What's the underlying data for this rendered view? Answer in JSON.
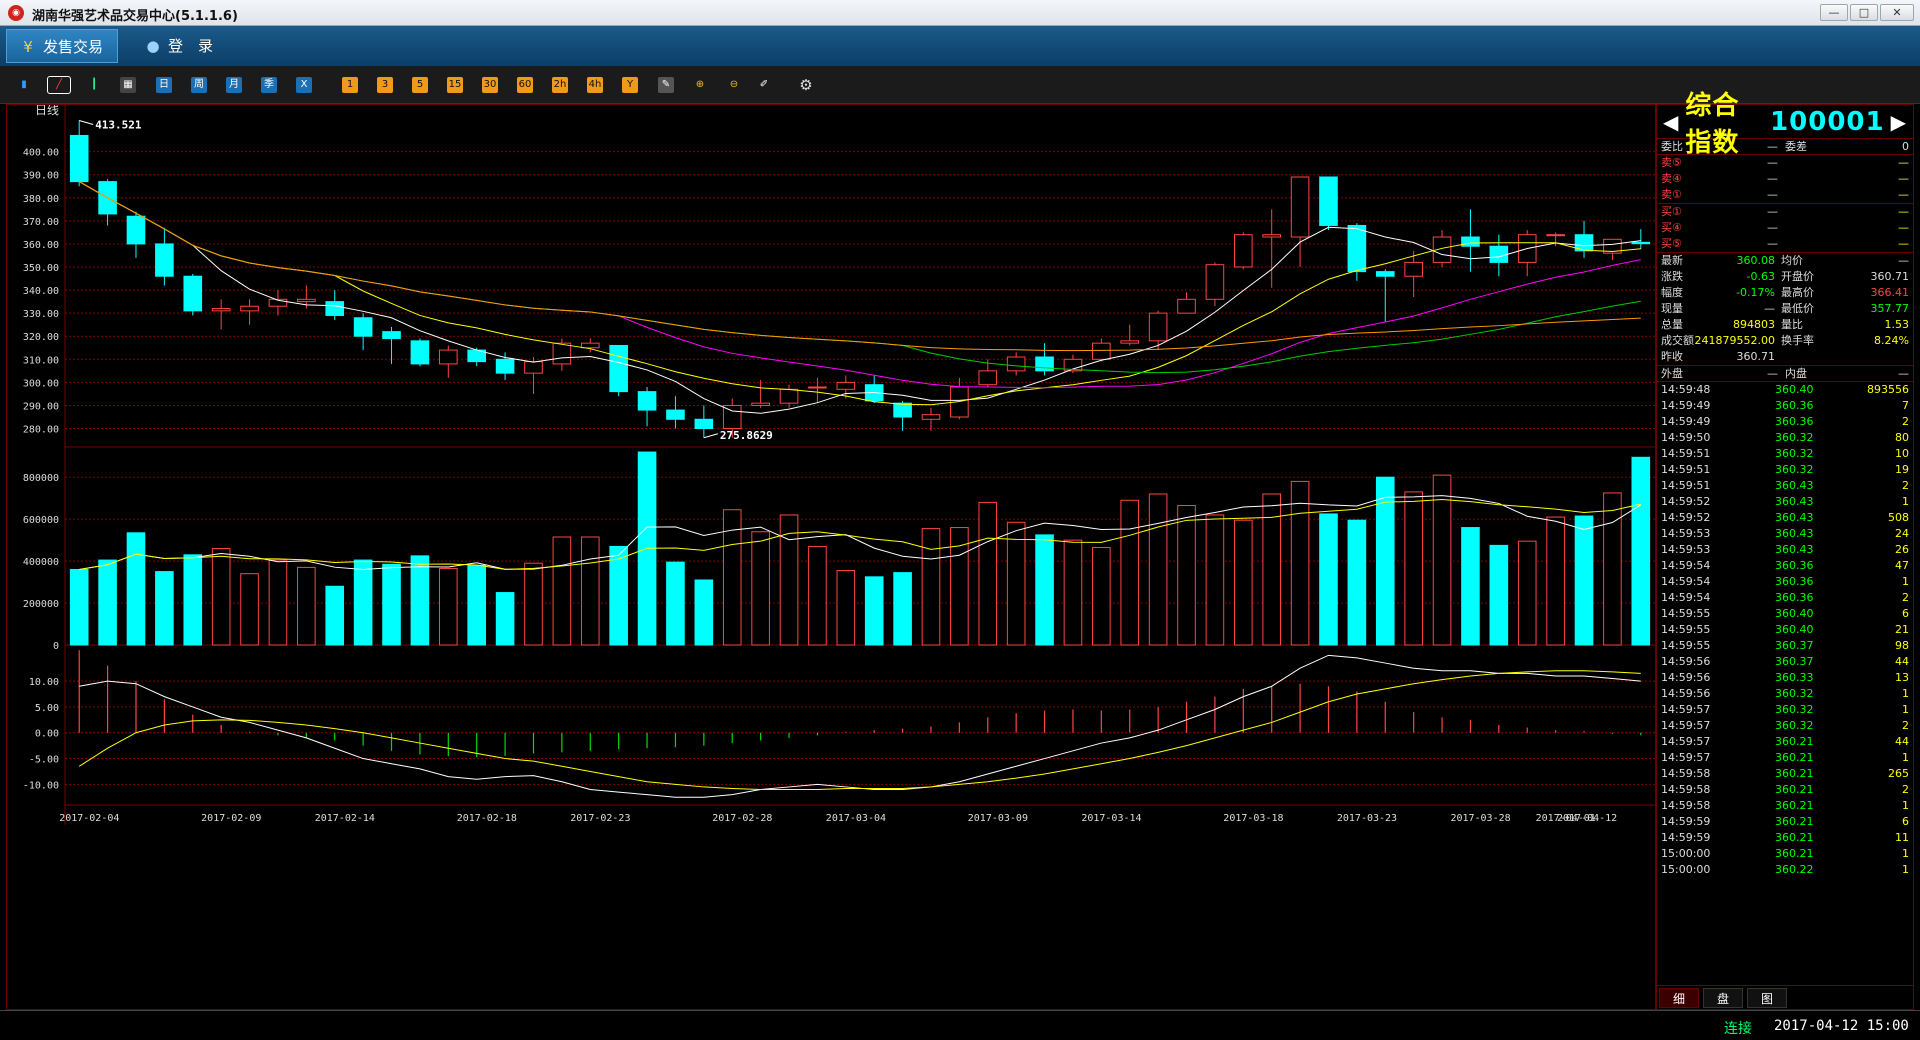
{
  "window": {
    "title": "湖南华强艺术品交易中心(5.1.1.6)",
    "controls": [
      "—",
      "□",
      "✕"
    ]
  },
  "menu": {
    "items": [
      {
        "label": "发售交易",
        "icon": "¥"
      },
      {
        "label": "登　录",
        "icon": "👤"
      }
    ]
  },
  "toolbar": {
    "icons": [
      "bar-chart-icon",
      "line-chart-icon",
      "candle-chart-icon",
      "calendar-icon"
    ],
    "periods_blue": [
      "日",
      "周",
      "月",
      "季",
      "X"
    ],
    "periods_orange": [
      "1",
      "3",
      "5",
      "15",
      "30",
      "60",
      "2h",
      "4h",
      "Y"
    ],
    "tools": [
      "draw-icon",
      "zoom-in-icon",
      "zoom-out-icon",
      "pen-icon",
      "gear-icon"
    ]
  },
  "chart_data": {
    "type": "candlestick",
    "period_label": "日线",
    "high_label": "413.521",
    "low_label": "275.8629",
    "price_ticks": [
      "400.00",
      "390.00",
      "380.00",
      "370.00",
      "360.00",
      "350.00",
      "340.00",
      "330.00",
      "320.00",
      "310.00",
      "300.00",
      "290.00",
      "280.00"
    ],
    "vol_ticks": [
      "800000",
      "600000",
      "400000",
      "200000",
      "0"
    ],
    "macd_ticks": [
      "10.00",
      "5.00",
      "0.00",
      "-5.00",
      "-10.00"
    ],
    "dates": [
      "2017-02-04",
      "2017-02-09",
      "2017-02-14",
      "2017-02-18",
      "2017-02-23",
      "2017-02-28",
      "2017-03-04",
      "2017-03-09",
      "2017-03-14",
      "2017-03-18",
      "2017-03-23",
      "2017-03-28",
      "2017-04-01",
      "2017-04-12"
    ],
    "candles": [
      [
        407,
        387,
        413.5,
        385
      ],
      [
        387,
        373,
        388,
        368
      ],
      [
        372,
        360,
        374,
        354
      ],
      [
        360,
        346,
        367,
        342
      ],
      [
        346,
        331,
        347,
        329
      ],
      [
        331,
        332,
        336,
        323
      ],
      [
        331,
        333,
        336,
        325
      ],
      [
        333,
        336,
        340,
        329
      ],
      [
        335,
        336,
        342,
        332
      ],
      [
        335,
        329,
        340,
        327
      ],
      [
        328,
        320,
        330,
        314
      ],
      [
        322,
        319,
        324,
        308
      ],
      [
        318,
        308,
        319,
        307
      ],
      [
        308,
        314,
        316,
        302
      ],
      [
        314,
        309,
        315,
        307
      ],
      [
        310,
        304,
        313,
        301
      ],
      [
        304,
        309,
        311,
        295
      ],
      [
        308,
        317,
        319,
        305
      ],
      [
        315,
        317,
        319,
        313
      ],
      [
        316,
        296,
        316,
        294
      ],
      [
        296,
        288,
        298,
        281
      ],
      [
        288,
        284,
        294,
        280
      ],
      [
        284,
        280,
        290,
        276
      ],
      [
        280,
        290,
        293,
        276
      ],
      [
        290,
        291,
        301,
        289
      ],
      [
        291,
        297,
        299,
        289
      ],
      [
        298,
        298,
        302,
        291
      ],
      [
        297,
        300,
        303,
        293
      ],
      [
        299,
        292,
        303,
        291
      ],
      [
        291,
        285,
        292,
        279
      ],
      [
        284,
        286,
        289,
        279
      ],
      [
        285,
        298,
        302,
        284
      ],
      [
        299,
        305,
        310,
        298
      ],
      [
        305,
        311,
        313,
        303
      ],
      [
        311,
        305,
        317,
        303
      ],
      [
        305,
        310,
        312,
        304
      ],
      [
        310,
        317,
        319,
        309
      ],
      [
        317,
        318,
        325,
        316
      ],
      [
        318,
        330,
        331,
        314
      ],
      [
        330,
        336,
        339,
        331
      ],
      [
        336,
        351,
        352,
        333
      ],
      [
        350,
        364,
        365,
        349
      ],
      [
        363,
        364,
        375,
        341
      ],
      [
        363,
        389,
        389,
        350
      ],
      [
        389,
        368,
        389,
        366
      ],
      [
        368,
        348,
        369,
        344
      ],
      [
        348,
        346,
        349,
        326
      ],
      [
        346,
        352,
        357,
        337
      ],
      [
        352,
        363,
        366,
        350
      ],
      [
        363,
        359,
        375,
        348
      ],
      [
        359,
        352,
        364,
        346
      ],
      [
        352,
        364,
        366,
        346
      ],
      [
        364,
        364,
        365,
        359
      ],
      [
        364,
        357,
        370,
        354
      ],
      [
        356,
        362,
        362,
        353
      ],
      [
        360.7,
        360.1,
        366.4,
        357.8
      ]
    ],
    "volumes": [
      360,
      405,
      535,
      350,
      430,
      460,
      340,
      405,
      370,
      280,
      405,
      385,
      425,
      365,
      380,
      250,
      390,
      515,
      515,
      470,
      920,
      395,
      310,
      645,
      540,
      620,
      470,
      355,
      325,
      345,
      555,
      560,
      680,
      585,
      525,
      500,
      465,
      690,
      720,
      665,
      620,
      595,
      720,
      780,
      625,
      595,
      800,
      730,
      810,
      560,
      475,
      495,
      610,
      615,
      725,
      895
    ],
    "macd_hist": [
      16,
      13,
      10,
      6.5,
      3.5,
      1.5,
      0.2,
      -0.5,
      -1,
      -1.5,
      -2.5,
      -3.5,
      -4.2,
      -4.5,
      -4.7,
      -4.5,
      -4,
      -3.8,
      -3.5,
      -3.2,
      -3,
      -2.8,
      -2.5,
      -2,
      -1.5,
      -1,
      -0.5,
      0.2,
      0.5,
      0.8,
      1.2,
      2,
      3,
      3.8,
      4.3,
      4.5,
      4.3,
      4.5,
      5,
      6,
      7,
      8.5,
      9,
      9.5,
      9,
      8,
      6,
      4,
      3,
      2.5,
      1.5,
      1,
      0.5,
      0.3,
      -0.2,
      -0.5
    ],
    "macd_dif": [
      9,
      10,
      9.5,
      7,
      5,
      3,
      2,
      0.5,
      -1,
      -3,
      -5,
      -6,
      -7,
      -8.5,
      -9,
      -8.5,
      -8.3,
      -9.5,
      -11,
      -11.5,
      -12,
      -12.5,
      -12.5,
      -12,
      -11,
      -10.5,
      -10,
      -10.5,
      -11,
      -11,
      -10.5,
      -9.5,
      -8,
      -6.5,
      -5,
      -3.5,
      -2,
      -1,
      0.5,
      2.5,
      4.5,
      7,
      9,
      12.5,
      15,
      14.5,
      13.5,
      12.5,
      12,
      12,
      11.5,
      11.5,
      11,
      11,
      10.5,
      10
    ],
    "macd_dea": [
      -6.5,
      -3,
      0,
      1.5,
      2.3,
      2.5,
      2.4,
      2,
      1.5,
      0.8,
      0,
      -1,
      -2,
      -3,
      -4,
      -5,
      -5.5,
      -6.5,
      -7.5,
      -8.5,
      -9.5,
      -10,
      -10.5,
      -10.8,
      -11,
      -11,
      -11,
      -10.8,
      -10.8,
      -10.8,
      -10.5,
      -10,
      -9.5,
      -8.8,
      -8,
      -7,
      -6,
      -5,
      -3.8,
      -2.5,
      -1,
      0.5,
      2,
      4,
      6,
      7.5,
      8.5,
      9.5,
      10.3,
      11,
      11.5,
      11.8,
      12,
      12,
      11.8,
      11.5
    ]
  },
  "quote": {
    "name": "综合指数",
    "code": "100001",
    "weibi": {
      "label": "委比",
      "value": "—",
      "label2": "委差",
      "value2": "0"
    },
    "sell": [
      {
        "label": "卖⑤",
        "price": "—",
        "vol": "—"
      },
      {
        "label": "卖④",
        "price": "—",
        "vol": "—"
      },
      {
        "label": "卖①",
        "price": "—",
        "vol": "—"
      }
    ],
    "buy": [
      {
        "label": "买①",
        "price": "—",
        "vol": "—"
      },
      {
        "label": "买④",
        "price": "—",
        "vol": "—"
      },
      {
        "label": "买⑤",
        "price": "—",
        "vol": "—"
      }
    ],
    "stats": [
      {
        "l1": "最新",
        "v1": "360.08",
        "c1": "cg",
        "l2": "均价",
        "v2": "—",
        "c2": "cw"
      },
      {
        "l1": "涨跌",
        "v1": "-0.63",
        "c1": "cg",
        "l2": "开盘价",
        "v2": "360.71",
        "c2": "cw"
      },
      {
        "l1": "幅度",
        "v1": "-0.17%",
        "c1": "cg",
        "l2": "最高价",
        "v2": "366.41",
        "c2": "cr"
      },
      {
        "l1": "现量",
        "v1": "—",
        "c1": "cw",
        "l2": "最低价",
        "v2": "357.77",
        "c2": "cg"
      },
      {
        "l1": "总量",
        "v1": "894803",
        "c1": "cyl",
        "l2": "量比",
        "v2": "1.53",
        "c2": "cyl"
      },
      {
        "l1": "成交额",
        "v1": "241879552.00",
        "c1": "cyl",
        "l2": "换手率",
        "v2": "8.24%",
        "c2": "cyl"
      },
      {
        "l1": "昨收",
        "v1": "360.71",
        "c1": "cw",
        "l2": "",
        "v2": "",
        "c2": "cw"
      }
    ],
    "outer_label": "外盘",
    "outer_value": "—",
    "inner_label": "内盘",
    "inner_value": "—",
    "ticks": [
      [
        "14:59:48",
        "360.40",
        "893556"
      ],
      [
        "14:59:49",
        "360.36",
        "7"
      ],
      [
        "14:59:49",
        "360.36",
        "2"
      ],
      [
        "14:59:50",
        "360.32",
        "80"
      ],
      [
        "14:59:51",
        "360.32",
        "10"
      ],
      [
        "14:59:51",
        "360.32",
        "19"
      ],
      [
        "14:59:51",
        "360.43",
        "2"
      ],
      [
        "14:59:52",
        "360.43",
        "1"
      ],
      [
        "14:59:52",
        "360.43",
        "508"
      ],
      [
        "14:59:53",
        "360.43",
        "24"
      ],
      [
        "14:59:53",
        "360.43",
        "26"
      ],
      [
        "14:59:54",
        "360.36",
        "47"
      ],
      [
        "14:59:54",
        "360.36",
        "1"
      ],
      [
        "14:59:54",
        "360.36",
        "2"
      ],
      [
        "14:59:55",
        "360.40",
        "6"
      ],
      [
        "14:59:55",
        "360.40",
        "21"
      ],
      [
        "14:59:55",
        "360.37",
        "98"
      ],
      [
        "14:59:56",
        "360.37",
        "44"
      ],
      [
        "14:59:56",
        "360.33",
        "13"
      ],
      [
        "14:59:56",
        "360.32",
        "1"
      ],
      [
        "14:59:57",
        "360.32",
        "1"
      ],
      [
        "14:59:57",
        "360.32",
        "2"
      ],
      [
        "14:59:57",
        "360.21",
        "44"
      ],
      [
        "14:59:57",
        "360.21",
        "1"
      ],
      [
        "14:59:58",
        "360.21",
        "265"
      ],
      [
        "14:59:58",
        "360.21",
        "2"
      ],
      [
        "14:59:58",
        "360.21",
        "1"
      ],
      [
        "14:59:59",
        "360.21",
        "6"
      ],
      [
        "14:59:59",
        "360.21",
        "11"
      ],
      [
        "15:00:00",
        "360.21",
        "1"
      ],
      [
        "15:00:00",
        "360.22",
        "1"
      ]
    ],
    "tabs": [
      "细",
      "盘",
      "图"
    ]
  },
  "status": {
    "connection": "连接",
    "datetime": "2017-04-12 15:00"
  },
  "colors": {
    "up": "#ff4444",
    "down": "#00ffff",
    "ma5": "#ffffff",
    "ma10": "#ffff00",
    "ma20": "#ff00ff",
    "ma30": "#00cc00",
    "ma60": "#ff9900",
    "grid": "#7a0000"
  }
}
